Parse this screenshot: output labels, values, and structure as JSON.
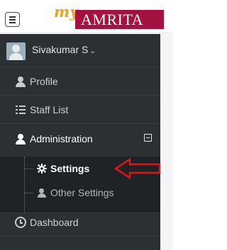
{
  "header": {
    "menu_icon": "hamburger-icon",
    "logo": {
      "prefix": "my",
      "brand": "AMRITA"
    }
  },
  "sidebar": {
    "user": {
      "name": "Sivakumar S",
      "avatar_icon": "user-avatar-icon",
      "dropdown_icon": "chevron-down-icon"
    },
    "items": [
      {
        "label": "Profile",
        "icon": "user-icon"
      },
      {
        "label": "Staff List",
        "icon": "list-icon"
      },
      {
        "label": "Administration",
        "icon": "user-icon",
        "expanded": true,
        "collapse_icon": "minus-square-icon"
      }
    ],
    "submenu": [
      {
        "label": "Settings",
        "icon": "gear-icon",
        "active": true
      },
      {
        "label": "Other Settings",
        "icon": "user-icon"
      }
    ],
    "bottom_items": [
      {
        "label": "Dashboard",
        "icon": "clock-icon"
      }
    ]
  },
  "annotation": {
    "icon": "red-arrow-icon",
    "color": "#e0141e"
  },
  "colors": {
    "sidebar_bg": "#2d3033",
    "submenu_bg": "#202326",
    "brand": "#a4123f",
    "logo_accent": "#f0a21e"
  }
}
